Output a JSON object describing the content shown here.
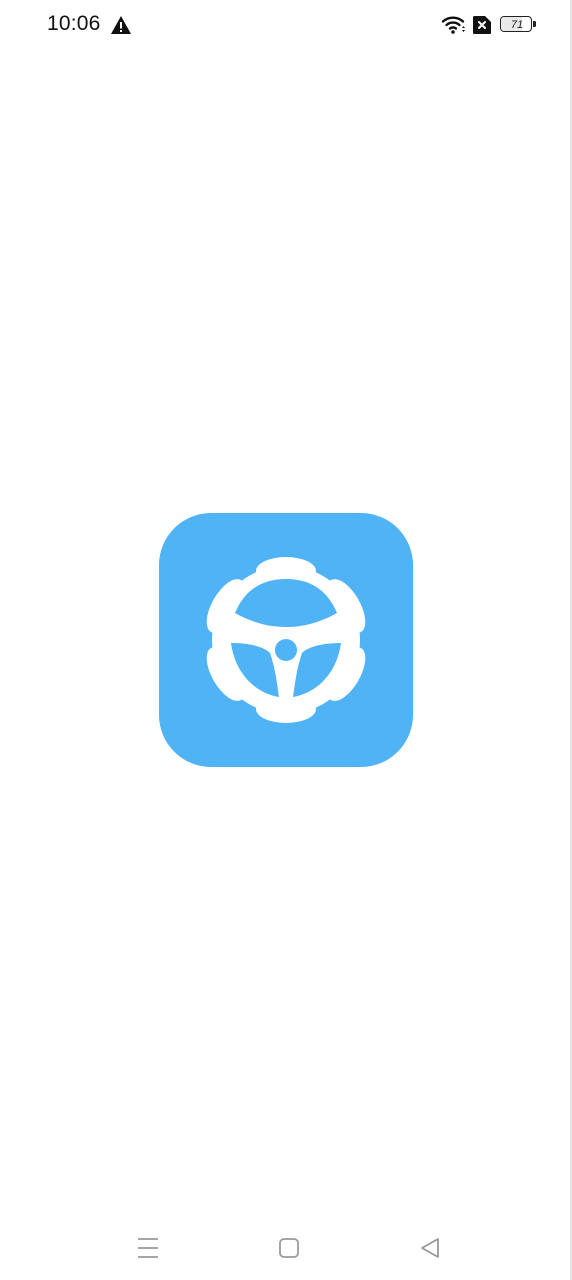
{
  "status_bar": {
    "time": "10:06",
    "icons": [
      "warning-icon",
      "wifi-icon",
      "no-sim-icon",
      "battery-icon"
    ],
    "battery_level": "71",
    "battery_fraction": 0.71
  },
  "splash": {
    "logo_icon": "steering-wheel-gear-icon",
    "logo_color": "#4fb3f6",
    "logo_glyph_color": "#ffffff"
  },
  "nav_bar": {
    "icons": [
      "menu-icon",
      "home-icon",
      "back-icon"
    ],
    "icon_color": "#9a9a9a"
  }
}
